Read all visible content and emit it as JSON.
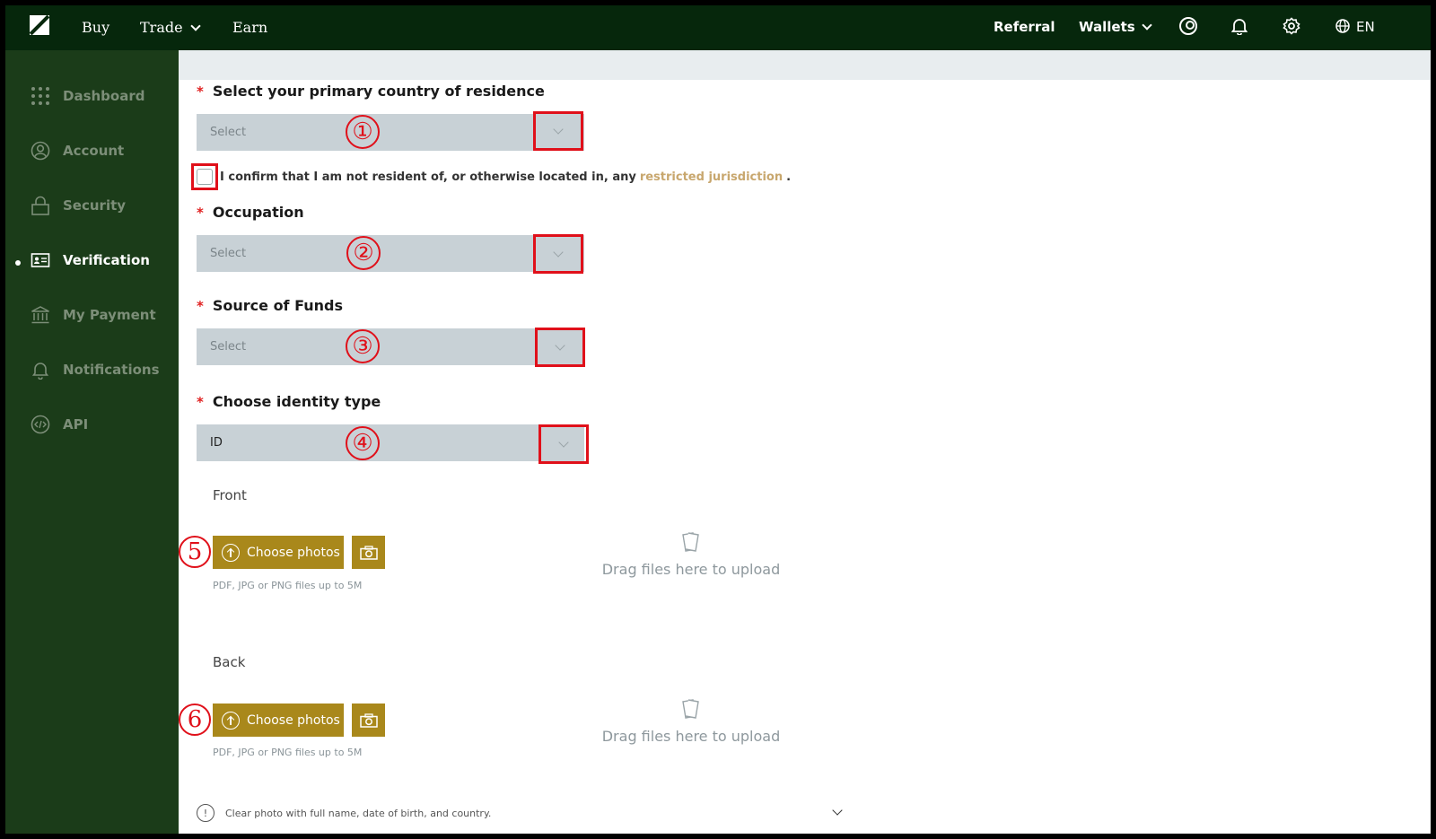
{
  "topnav": {
    "links": [
      "Buy",
      "Trade",
      "Earn"
    ],
    "referral": "Referral",
    "wallets": "Wallets",
    "lang": "EN"
  },
  "sidebar": {
    "items": [
      {
        "label": "Dashboard",
        "icon": "grid-icon"
      },
      {
        "label": "Account",
        "icon": "user-icon"
      },
      {
        "label": "Security",
        "icon": "lock-icon"
      },
      {
        "label": "Verification",
        "icon": "id-card-icon",
        "active": true
      },
      {
        "label": "My Payment",
        "icon": "bank-icon"
      },
      {
        "label": "Notifications",
        "icon": "bell-icon"
      },
      {
        "label": "API",
        "icon": "code-icon"
      }
    ]
  },
  "form": {
    "country_label": "Select your primary country of residence",
    "country_value": "Select",
    "confirm_text": "I confirm that I am not resident of, or otherwise located in, any",
    "confirm_link": "restricted jurisdiction",
    "confirm_end": ".",
    "occupation_label": "Occupation",
    "occupation_value": "Select",
    "funds_label": "Source of Funds",
    "funds_value": "Select",
    "identity_label": "Choose identity type",
    "identity_value": "ID",
    "front_label": "Front",
    "back_label": "Back",
    "choose_photos": "Choose photos",
    "file_hint": "PDF, JPG or PNG files up to 5M",
    "drop_text": "Drag files here to upload",
    "info_text": "Clear photo with full name, date of birth, and country."
  },
  "annotations": [
    "①",
    "②",
    "③",
    "④",
    "5",
    "6"
  ],
  "colors": {
    "topnav_bg": "#06270c",
    "sidebar_bg": "#1b3c19",
    "gold": "#a9881b",
    "link_gold": "#c8a76e",
    "annotation_red": "#e0101a",
    "select_bg": "#c8d1d6"
  }
}
